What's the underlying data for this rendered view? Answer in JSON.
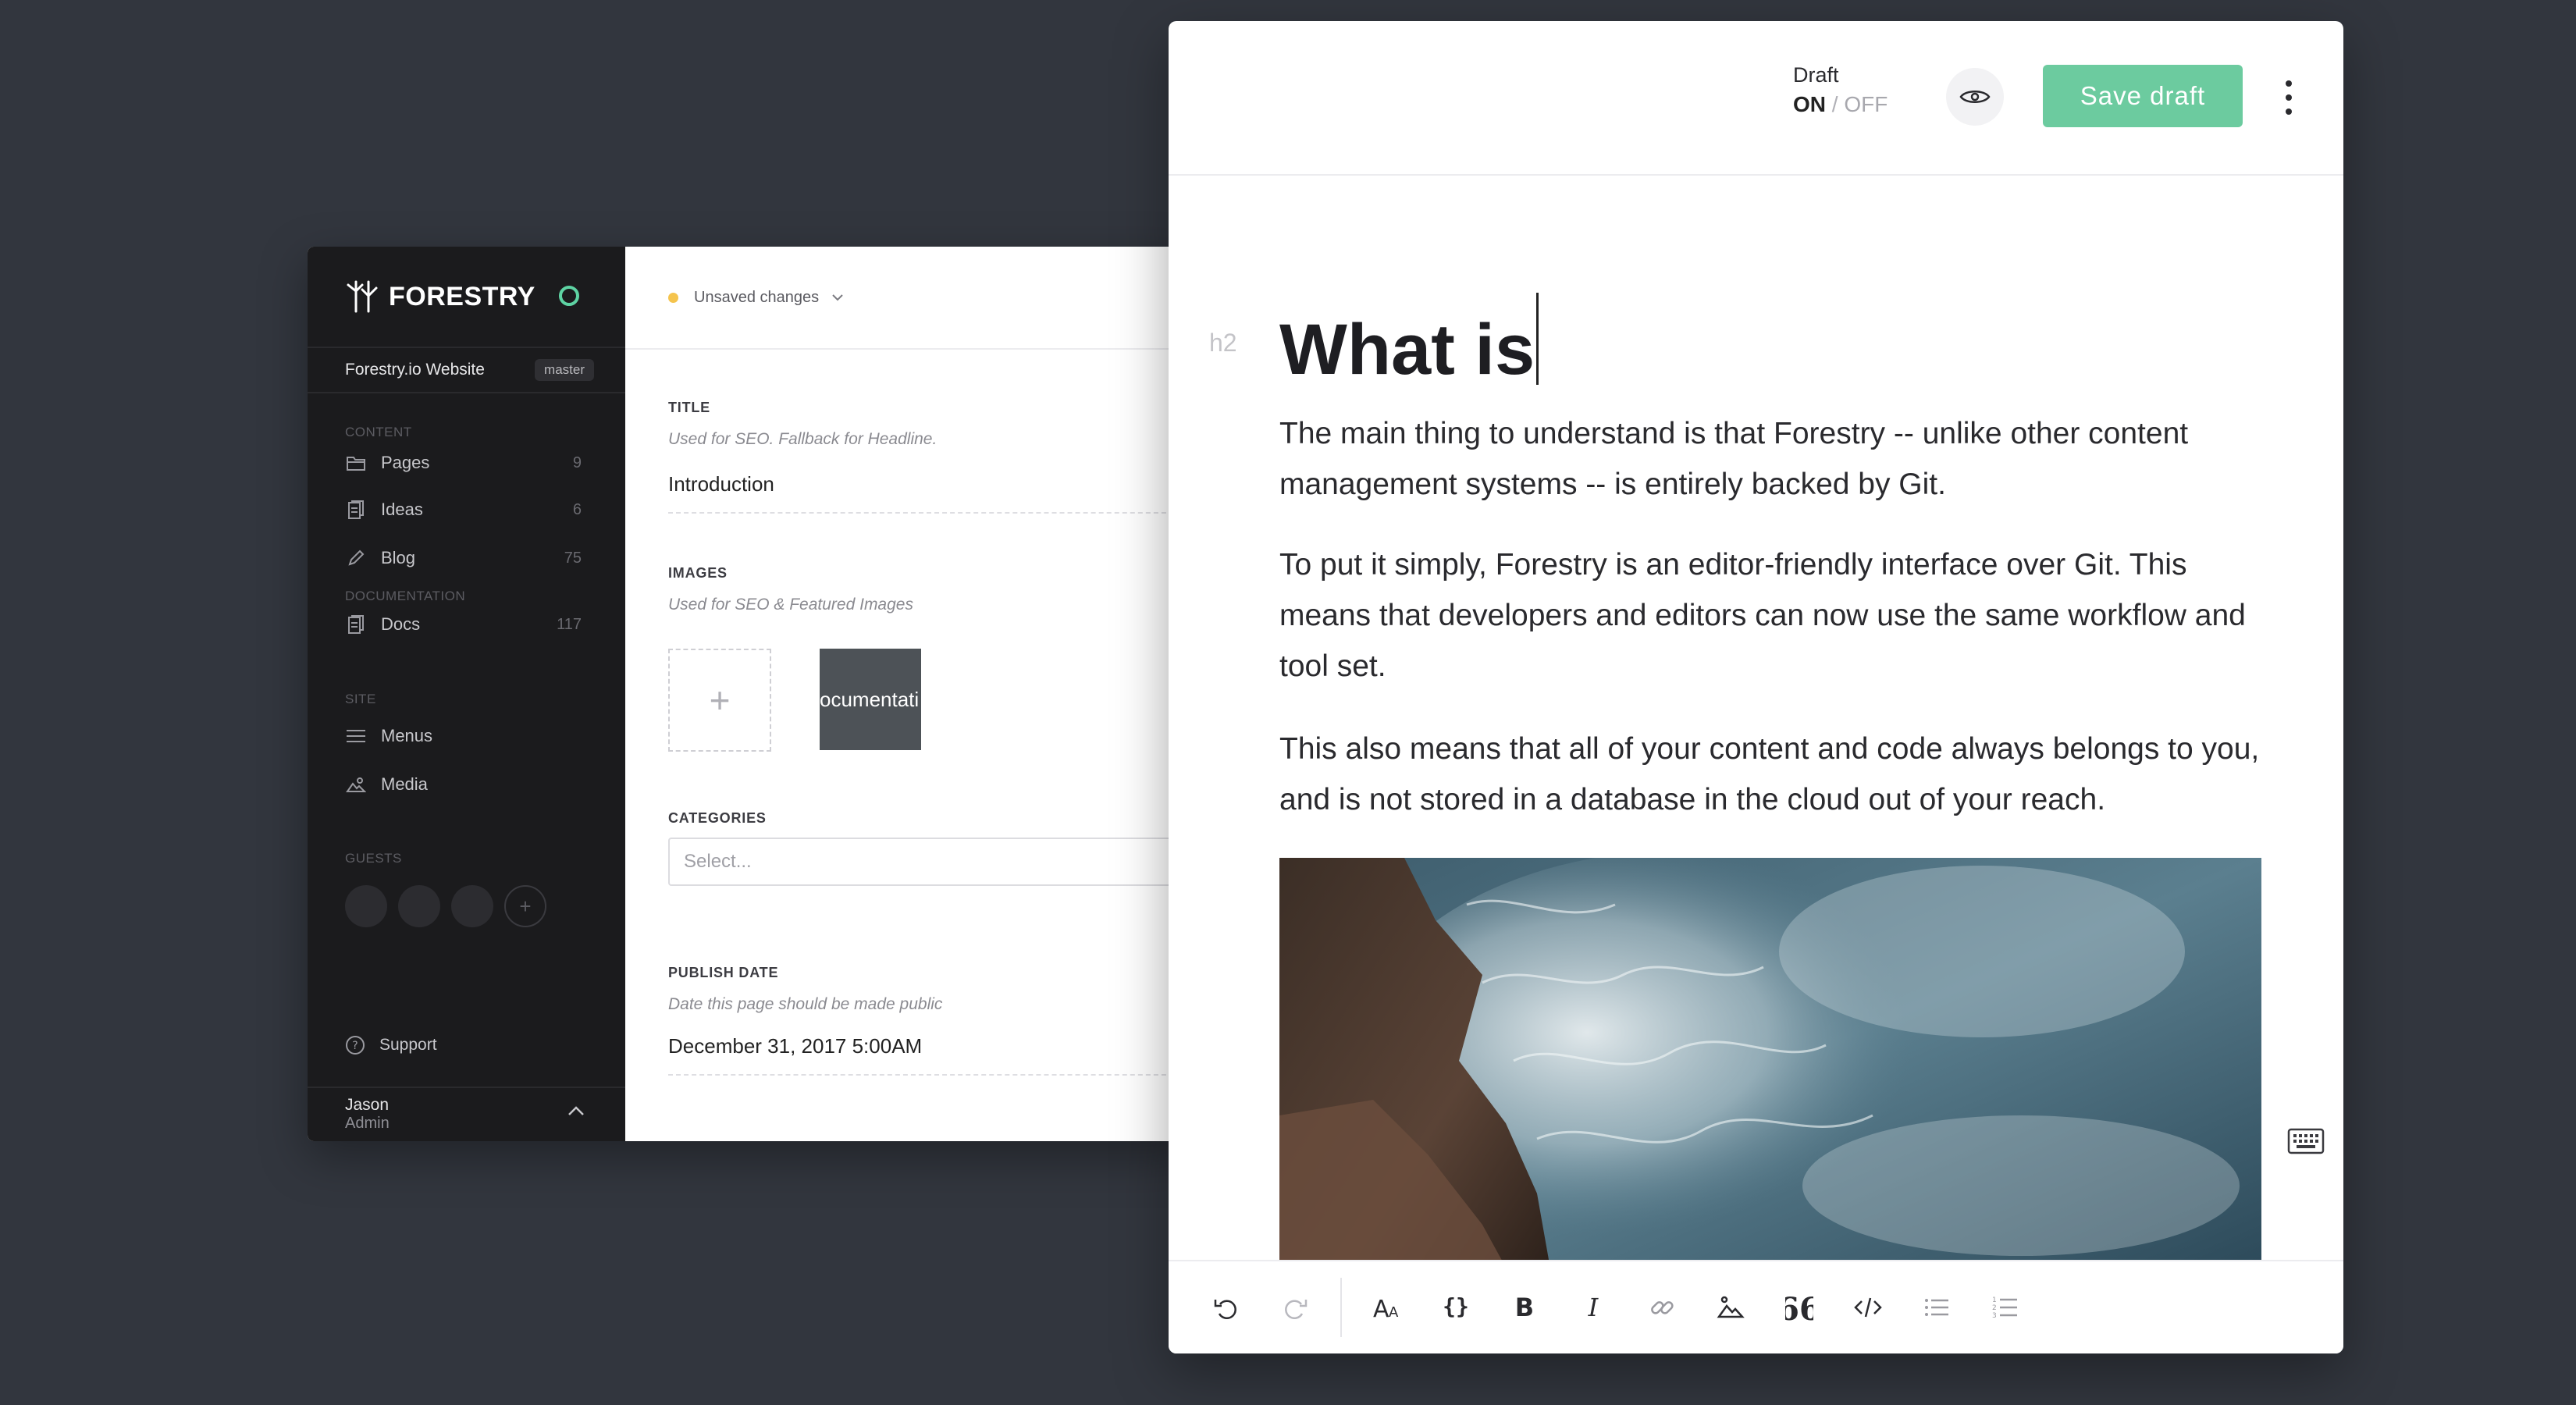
{
  "sidebar": {
    "brand": "FORESTRY",
    "site_name": "Forestry.io Website",
    "branch": "master",
    "sections": {
      "content": "CONTENT",
      "documentation": "DOCUMENTATION",
      "site": "SITE",
      "guests": "GUESTS"
    },
    "items": [
      {
        "label": "Pages",
        "count": "9",
        "icon": "folder-icon"
      },
      {
        "label": "Ideas",
        "count": "6",
        "icon": "documents-icon"
      },
      {
        "label": "Blog",
        "count": "75",
        "icon": "pencil-icon"
      },
      {
        "label": "Docs",
        "count": "117",
        "icon": "documents-icon"
      },
      {
        "label": "Menus",
        "count": "",
        "icon": "menu-icon"
      },
      {
        "label": "Media",
        "count": "",
        "icon": "image-icon"
      }
    ],
    "support": "Support",
    "user": {
      "name": "Jason",
      "role": "Admin"
    }
  },
  "fields": {
    "unsaved": "Unsaved changes",
    "title": {
      "label": "TITLE",
      "help": "Used for SEO. Fallback for Headline.",
      "value": "Introduction"
    },
    "images": {
      "label": "IMAGES",
      "help": "Used for SEO & Featured Images",
      "thumb_text": "ocumentati"
    },
    "categories": {
      "label": "CATEGORIES",
      "placeholder": "Select..."
    },
    "publish_date": {
      "label": "PUBLISH DATE",
      "help": "Date this page should be made public",
      "value": "December 31, 2017 5:00AM"
    }
  },
  "editor": {
    "draft_label": "Draft",
    "draft_on": "ON",
    "draft_sep": "/",
    "draft_off": "OFF",
    "save_label": "Save draft",
    "heading_marker": "h2",
    "heading": "What is",
    "paragraphs": [
      "The main thing to understand is that Forestry -- unlike other content management systems -- is entirely backed by Git.",
      "To put it simply, Forestry is an editor-friendly interface over Git. This means that developers and editors can now use the same workflow and tool set.",
      "This also means that all of your content and code always belongs to you, and is not stored in a database in the cloud out of your reach."
    ],
    "toolbar": [
      "undo-icon",
      "redo-icon",
      "text-size-icon",
      "braces-icon",
      "bold-icon",
      "italic-icon",
      "link-icon",
      "image-icon",
      "quote-icon",
      "code-icon",
      "bullet-list-icon",
      "numbered-list-icon"
    ]
  },
  "colors": {
    "accent": "#6ccb9f",
    "status": "#5ed3a3",
    "unsaved_dot": "#f5c44d",
    "background": "#32363e",
    "sidebar": "#1b1b1d"
  }
}
